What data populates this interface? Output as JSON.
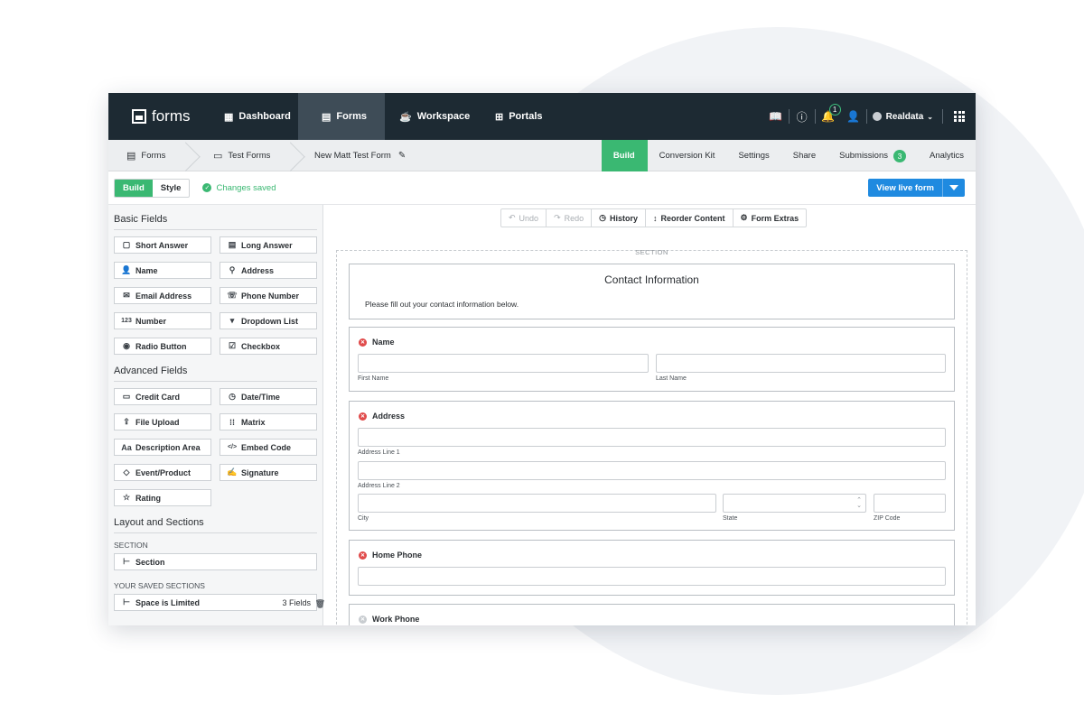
{
  "brand": "forms",
  "nav": {
    "dashboard": "Dashboard",
    "forms": "Forms",
    "workspace": "Workspace",
    "portals": "Portals"
  },
  "topright": {
    "notifications": "1",
    "user": "Realdata"
  },
  "breadcrumb": {
    "root": "Forms",
    "folder": "Test Forms",
    "form": "New Matt Test Form"
  },
  "tabs": {
    "build": "Build",
    "conversion": "Conversion Kit",
    "settings": "Settings",
    "share": "Share",
    "submissions": "Submissions",
    "submissions_count": "3",
    "analytics": "Analytics"
  },
  "toolbar": {
    "build": "Build",
    "style": "Style",
    "status": "Changes saved",
    "live": "View live form"
  },
  "sidebar": {
    "basic_title": "Basic Fields",
    "basic": [
      "Short Answer",
      "Long Answer",
      "Name",
      "Address",
      "Email Address",
      "Phone Number",
      "Number",
      "Dropdown List",
      "Radio Button",
      "Checkbox"
    ],
    "advanced_title": "Advanced Fields",
    "advanced": [
      "Credit Card",
      "Date/Time",
      "File Upload",
      "Matrix",
      "Description Area",
      "Embed Code",
      "Event/Product",
      "Signature",
      "Rating"
    ],
    "layout_title": "Layout and Sections",
    "section_label": "SECTION",
    "section_btn": "Section",
    "saved_label": "YOUR SAVED SECTIONS",
    "saved_name": "Space is Limited",
    "saved_count": "3 Fields"
  },
  "canvas_toolbar": {
    "undo": "Undo",
    "redo": "Redo",
    "history": "History",
    "reorder": "Reorder Content",
    "extras": "Form Extras"
  },
  "form": {
    "section_tag": "SECTION",
    "title": "Contact Information",
    "description": "Please fill out your contact information below.",
    "name_label": "Name",
    "first_name": "First Name",
    "last_name": "Last Name",
    "address_label": "Address",
    "line1": "Address Line 1",
    "line2": "Address Line 2",
    "city": "City",
    "state": "State",
    "zip": "ZIP Code",
    "home_phone": "Home Phone",
    "work_phone": "Work Phone"
  }
}
